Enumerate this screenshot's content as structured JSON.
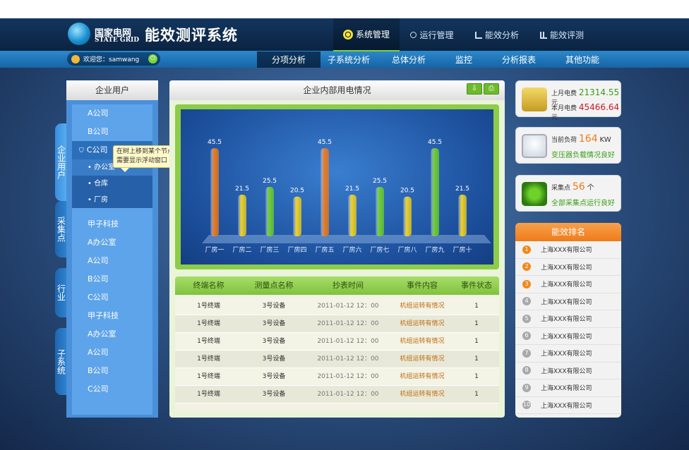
{
  "brand": {
    "cn": "国家电网",
    "en": "STATE GRID",
    "system": "能效测评系统"
  },
  "main_nav": [
    {
      "label": "系统管理",
      "icon": "radiation-icon",
      "active": true
    },
    {
      "label": "运行管理",
      "icon": "nodes-icon",
      "active": false
    },
    {
      "label": "能效分析",
      "icon": "bar-chart-icon",
      "active": false
    },
    {
      "label": "能效评测",
      "icon": "bars-icon",
      "active": false
    }
  ],
  "user": {
    "greeting": "欢迎您：samwang"
  },
  "sub_nav": [
    {
      "label": "分项分析",
      "active": true
    },
    {
      "label": "子系统分析",
      "active": false
    },
    {
      "label": "总体分析",
      "active": false
    },
    {
      "label": "监控",
      "active": false
    },
    {
      "label": "分析报表",
      "active": false
    },
    {
      "label": "其他功能",
      "active": false
    }
  ],
  "left_tabs": [
    {
      "label": "企业用户",
      "active": true
    },
    {
      "label": "采集点",
      "active": false
    },
    {
      "label": "行业",
      "active": false
    },
    {
      "label": "子系统",
      "active": false
    }
  ],
  "left_panel": {
    "title": "企业用户",
    "items": [
      "A公司",
      "B公司"
    ],
    "selected": "C公司",
    "subitems": [
      "• 办公室",
      "• 仓库",
      "• 厂房"
    ],
    "items_after": [
      "甲子科技",
      "A办公室",
      "A公司",
      "B公司",
      "C公司",
      "甲子科技",
      "A办公室",
      "A公司",
      "B公司",
      "C公司"
    ]
  },
  "tooltip": {
    "text": "在树上移到某个节点时需要显示浮动窗口"
  },
  "center": {
    "title": "企业内部用电情况"
  },
  "chart_data": {
    "type": "bar",
    "categories": [
      "厂房一",
      "厂房二",
      "厂房三",
      "厂房四",
      "厂房五",
      "厂房六",
      "厂房七",
      "厂房八",
      "厂房九",
      "厂房十"
    ],
    "values": [
      45.5,
      21.5,
      25.5,
      20.5,
      45.5,
      21.5,
      25.5,
      20.5,
      45.5,
      21.5
    ],
    "colors": [
      "#f07a1a",
      "#f1d21e",
      "#6fd12a",
      "#f1d21e",
      "#f07a1a",
      "#f1d21e",
      "#6fd12a",
      "#f1d21e",
      "#6fd12a",
      "#f1d21e"
    ],
    "ylim": [
      0,
      50
    ]
  },
  "table": {
    "headers": [
      "终端名称",
      "测量点名称",
      "抄表时间",
      "事件内容",
      "事件状态"
    ],
    "rows": [
      [
        "1号终端",
        "3号设备",
        "2011-01-12 12：00",
        "机组运转有情况",
        "1"
      ],
      [
        "1号终端",
        "3号设备",
        "2011-01-12 12：00",
        "机组运转有情况",
        "1"
      ],
      [
        "1号终端",
        "3号设备",
        "2011-01-12 12：00",
        "机组运转有情况",
        "1"
      ],
      [
        "1号终端",
        "3号设备",
        "2011-01-12 12：00",
        "机组运转有情况",
        "1"
      ],
      [
        "1号终端",
        "3号设备",
        "2011-01-12 12：00",
        "机组运转有情况",
        "1"
      ],
      [
        "1号终端",
        "3号设备",
        "2011-01-12 12：00",
        "机组运转有情况",
        "1"
      ]
    ]
  },
  "cards": {
    "electricity": {
      "last_label": "上月电费",
      "last_value": "21314.55",
      "this_label": "本月电费",
      "this_value": "45466.64",
      "unit": "元"
    },
    "load": {
      "label": "当前负荷",
      "value": "164",
      "unit": "KW",
      "status": "变压器负载情况良好"
    },
    "points": {
      "label": "采集点",
      "value": "56",
      "unit": "个",
      "status": "全部采集点运行良好"
    }
  },
  "ranking": {
    "title": "能效排名",
    "items": [
      "上海XXX有限公司",
      "上海XXX有限公司",
      "上海XXX有限公司",
      "上海XXX有限公司",
      "上海XXX有限公司",
      "上海XXX有限公司",
      "上海XXX有限公司",
      "上海XXX有限公司",
      "上海XXX有限公司",
      "上海XXX有限公司"
    ]
  }
}
